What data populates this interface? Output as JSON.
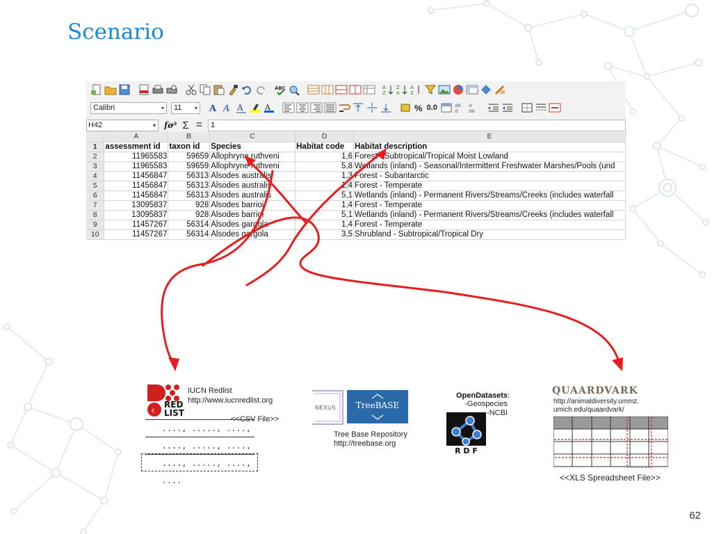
{
  "slide": {
    "title": "Scenario",
    "page_number": "62"
  },
  "colors": {
    "title": "#1e88d8",
    "arrow": "#e81c1c",
    "network": "#d8e4ea",
    "treebase": "#2a6aa8",
    "dashed_blue": "#2c2ccf"
  },
  "spreadsheet": {
    "font_name": "Calibri",
    "font_size": "11",
    "cell_ref": "H42",
    "formula_value": "1",
    "toolbar_labels": {
      "percent": "%",
      "decimal": "0.0"
    },
    "formula_icons": {
      "function": "fø³",
      "sum": "Σ",
      "equals": "="
    },
    "column_letters": [
      "A",
      "B",
      "C",
      "D",
      "E"
    ],
    "rows": [
      {
        "n": "1",
        "cells": [
          "assessment id",
          "taxon id",
          "Species",
          "Habitat code",
          "Habitat description"
        ]
      },
      {
        "n": "2",
        "cells": [
          "11965583",
          "59659",
          "Allophryne ruthveni",
          "1,6",
          "Forest - Subtropical/Tropical Moist Lowland"
        ]
      },
      {
        "n": "3",
        "cells": [
          "11965583",
          "59659",
          "Allophryne ruthveni",
          "5,8",
          "Wetlands (inland) - Seasonal/Intermittent Freshwater Marshes/Pools (und"
        ]
      },
      {
        "n": "4",
        "cells": [
          "11456847",
          "56313",
          "Alsodes australis",
          "1,3",
          "Forest - Subantarctic"
        ]
      },
      {
        "n": "5",
        "cells": [
          "11456847",
          "56313",
          "Alsodes australis",
          "1,4",
          "Forest - Temperate"
        ]
      },
      {
        "n": "6",
        "cells": [
          "11456847",
          "56313",
          "Alsodes australis",
          "5,1",
          "Wetlands (inland) - Permanent Rivers/Streams/Creeks (includes waterfall"
        ]
      },
      {
        "n": "7",
        "cells": [
          "13095837",
          "928",
          "Alsodes barrioi",
          "1,4",
          "Forest - Temperate"
        ]
      },
      {
        "n": "8",
        "cells": [
          "13095837",
          "928",
          "Alsodes barrioi",
          "5,1",
          "Wetlands (inland) - Permanent Rivers/Streams/Creeks (includes waterfall"
        ]
      },
      {
        "n": "9",
        "cells": [
          "11457267",
          "56314",
          "Alsodes gargola",
          "1,4",
          "Forest - Temperate"
        ]
      },
      {
        "n": "10",
        "cells": [
          "11457267",
          "56314",
          "Alsodes gargola",
          "3,5",
          "Shrubland - Subtropical/Tropical Dry"
        ]
      }
    ]
  },
  "sources": {
    "iucn": {
      "logo_text_1": "RED",
      "logo_text_2": "LIST",
      "name": "IUCN Redlist",
      "url": "http://www.iucnredlist.org",
      "file_label": "<<CSV File>>",
      "csv_lines": [
        "...., ....., ...., ....",
        "...., ....., ...., ....",
        "...., ....., ...., ...."
      ]
    },
    "treebase": {
      "nexus_label": "NEXUS",
      "logo_text": "TreeBASE",
      "name": "Tree Base Repository",
      "url": "http://treebase.org"
    },
    "opendatasets": {
      "title": "OpenDatasets",
      "title_suffix": ":",
      "items": [
        "-Geospecies",
        "-NCBI"
      ],
      "rdf_label": "R D F"
    },
    "quaardvark": {
      "logo_text": "QUAARDVARK",
      "url_lines": [
        "http://animaldiversity.ummz.",
        "umich.edu/quaardvark/"
      ],
      "file_label": "<<XLS Spreadsheet File>>"
    }
  }
}
